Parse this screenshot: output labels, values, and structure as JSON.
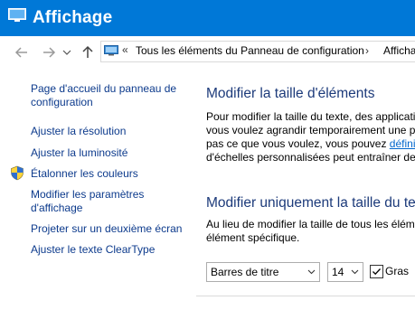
{
  "window": {
    "title": "Affichage"
  },
  "address": {
    "sep": "«",
    "crumb1": "Tous les éléments du Panneau de configuration",
    "sep2": "›",
    "crumb2": "Affichage"
  },
  "sidebar": {
    "home_line1": "Page d'accueil du panneau de",
    "home_line2": "configuration",
    "items": [
      "Ajuster la résolution",
      "Ajuster la luminosité",
      "Étalonner les couleurs",
      "Modifier les paramètres",
      "d'affichage",
      "Projeter sur un deuxième écran",
      "Ajuster le texte ClearType"
    ]
  },
  "main": {
    "section1_title": "Modifier la taille d'éléments",
    "section1_lines": [
      "Pour modifier la taille du texte, des applicati",
      "vous voulez agrandir temporairement une p",
      "pas ce que vous voulez, vous pouvez ",
      "d'échelles personnalisées peut entraîner des"
    ],
    "section1_link": "définir",
    "section2_title": "Modifier uniquement la taille du te",
    "section2_lines": [
      "Au lieu de modifier la taille de tous les élém",
      "élément spécifique."
    ],
    "element_select": "Barres de titre",
    "size_select": "14",
    "bold_label": "Gras",
    "bold_checked": true
  }
}
